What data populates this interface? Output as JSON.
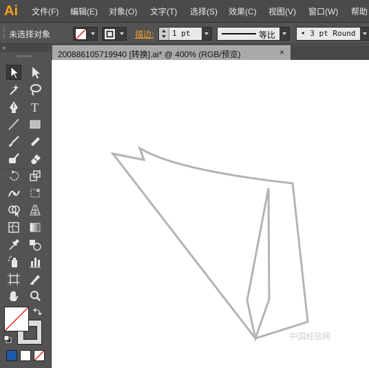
{
  "app": {
    "logo_text": "Ai",
    "logo_color": "#f7a21b"
  },
  "menu": [
    "文件(F)",
    "编辑(E)",
    "对象(O)",
    "文字(T)",
    "选择(S)",
    "效果(C)",
    "视图(V)",
    "窗口(W)",
    "帮助"
  ],
  "control_bar": {
    "selection_status": "未选择对象",
    "stroke_label": "描边:",
    "stroke_weight": "1 pt",
    "profile_label": "等比",
    "brush_label": "• 3 pt Round"
  },
  "document": {
    "tab_title": "200886105719940 [转换].ai* @ 400% (RGB/预览)",
    "close_glyph": "×"
  },
  "colors": {
    "ui_panel": "#535353",
    "canvas": "#ffffff",
    "path_stroke": "#b3b3b3",
    "accent": "#f0a030"
  },
  "watermark": "中国经验网"
}
